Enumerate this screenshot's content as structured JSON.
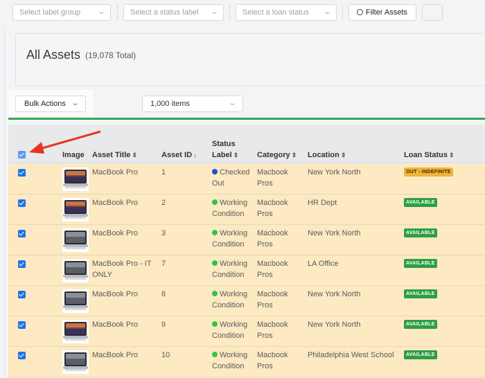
{
  "filters": {
    "label_group_placeholder": "Select label group",
    "status_label_placeholder": "Select a status label",
    "loan_status_placeholder": "Select a loan status",
    "filter_button": "Filter Assets"
  },
  "header": {
    "title": "All Assets",
    "total": "(19,078 Total)"
  },
  "toolbar": {
    "bulk_actions": "Bulk Actions",
    "items_per_page": "1,000 items"
  },
  "table": {
    "columns": {
      "image": "Image",
      "asset_title": "Asset Title",
      "asset_id": "Asset ID",
      "status_label_line1": "Status",
      "status_label_line2": "Label",
      "category": "Category",
      "location": "Location",
      "loan_status": "Loan Status"
    },
    "rows": [
      {
        "title1": "MacBook Pro",
        "title2": "",
        "id": "1",
        "status1": "Checked",
        "status2": "Out",
        "status_color": "#1a4fd6",
        "cat1": "Macbook",
        "cat2": "Pros",
        "location": "New York North",
        "loan": "OUT - INDEFINITE",
        "loan_type": "out",
        "thumb": "color"
      },
      {
        "title1": "MacBook Pro",
        "title2": "",
        "id": "2",
        "status1": "Working",
        "status2": "Condition",
        "status_color": "#35c24a",
        "cat1": "Macbook",
        "cat2": "Pros",
        "location": "HR Dept",
        "loan": "AVAILABLE",
        "loan_type": "avail",
        "thumb": "color"
      },
      {
        "title1": "MacBook Pro",
        "title2": "",
        "id": "3",
        "status1": "Working",
        "status2": "Condition",
        "status_color": "#35c24a",
        "cat1": "Macbook",
        "cat2": "Pros",
        "location": "New York North",
        "loan": "AVAILABLE",
        "loan_type": "avail",
        "thumb": "plain"
      },
      {
        "title1": "MacBook Pro - IT",
        "title2": "ONLY",
        "id": "7",
        "status1": "Working",
        "status2": "Condition",
        "status_color": "#35c24a",
        "cat1": "Macbook",
        "cat2": "Pros",
        "location": "LA Office",
        "loan": "AVAILABLE",
        "loan_type": "avail",
        "thumb": "plain"
      },
      {
        "title1": "MacBook Pro",
        "title2": "",
        "id": "8",
        "status1": "Working",
        "status2": "Condition",
        "status_color": "#35c24a",
        "cat1": "Macbook",
        "cat2": "Pros",
        "location": "New York North",
        "loan": "AVAILABLE",
        "loan_type": "avail",
        "thumb": "plain"
      },
      {
        "title1": "MacBook Pro",
        "title2": "",
        "id": "9",
        "status1": "Working",
        "status2": "Condition",
        "status_color": "#35c24a",
        "cat1": "Macbook",
        "cat2": "Pros",
        "location": "New York North",
        "loan": "AVAILABLE",
        "loan_type": "avail",
        "thumb": "color"
      },
      {
        "title1": "MacBook Pro",
        "title2": "",
        "id": "10",
        "status1": "Working",
        "status2": "Condition",
        "status_color": "#35c24a",
        "cat1": "Macbook",
        "cat2": "Pros",
        "location": "Philadelphia West School",
        "loan": "AVAILABLE",
        "loan_type": "avail",
        "thumb": "plain"
      }
    ]
  },
  "icons": {
    "chevron": "chevron-down-icon",
    "search": "search-icon",
    "sort": "sort-icon",
    "arrow": "red-arrow-annotation"
  },
  "colors": {
    "accent_green": "#2fa84f",
    "row_highlight": "#fde9c2",
    "available": "#2e9e46",
    "out": "#f2b33d",
    "arrow_red": "#e8341c"
  }
}
